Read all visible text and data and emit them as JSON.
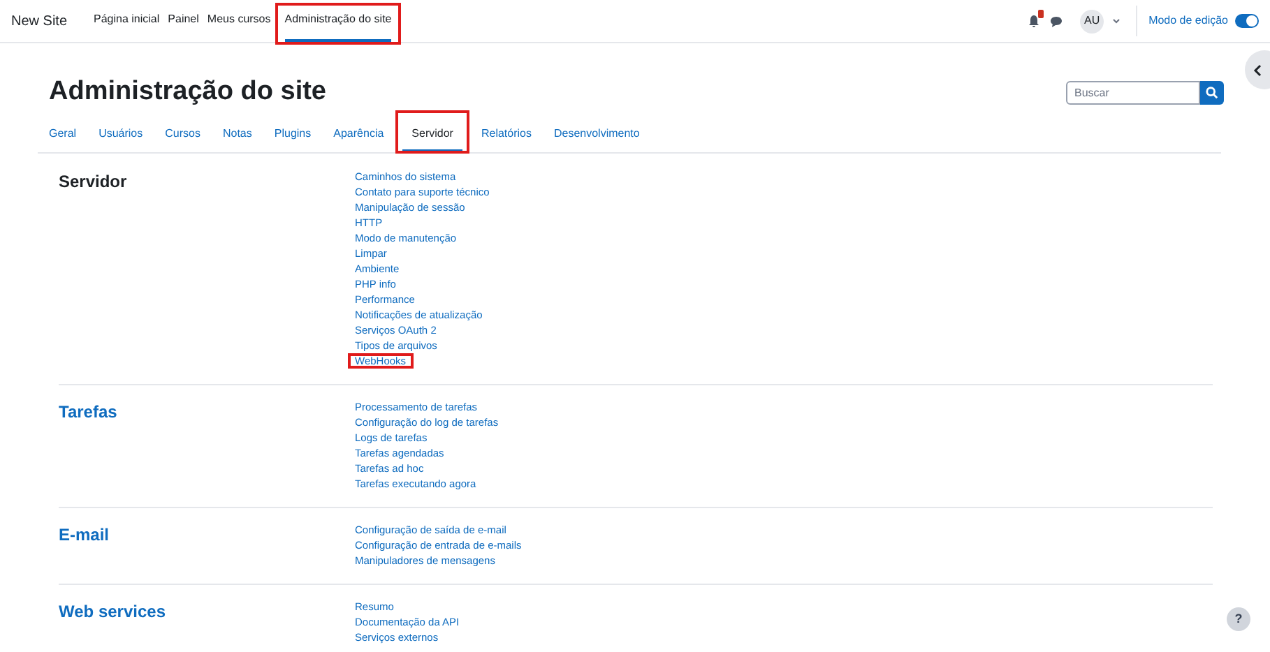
{
  "navbar": {
    "site_name": "New Site",
    "items": [
      {
        "label": "Página inicial",
        "selected": false,
        "highlighted": false
      },
      {
        "label": "Painel",
        "selected": false,
        "highlighted": false
      },
      {
        "label": "Meus cursos",
        "selected": false,
        "highlighted": false
      },
      {
        "label": "Administração do site",
        "selected": true,
        "highlighted": true
      }
    ],
    "user_initials": "AU",
    "edit_mode": {
      "label": "Modo de edição",
      "on": true
    }
  },
  "page": {
    "title": "Administração do site",
    "search": {
      "placeholder": "Buscar"
    },
    "tabs": [
      {
        "label": "Geral",
        "selected": false,
        "highlighted": false
      },
      {
        "label": "Usuários",
        "selected": false,
        "highlighted": false
      },
      {
        "label": "Cursos",
        "selected": false,
        "highlighted": false
      },
      {
        "label": "Notas",
        "selected": false,
        "highlighted": false
      },
      {
        "label": "Plugins",
        "selected": false,
        "highlighted": false
      },
      {
        "label": "Aparência",
        "selected": false,
        "highlighted": false
      },
      {
        "label": "Servidor",
        "selected": true,
        "highlighted": true
      },
      {
        "label": "Relatórios",
        "selected": false,
        "highlighted": false
      },
      {
        "label": "Desenvolvimento",
        "selected": false,
        "highlighted": false
      }
    ],
    "sections": [
      {
        "heading": "Servidor",
        "is_link": false,
        "links": [
          {
            "label": "Caminhos do sistema",
            "highlighted": false
          },
          {
            "label": "Contato para suporte técnico",
            "highlighted": false
          },
          {
            "label": "Manipulação de sessão",
            "highlighted": false
          },
          {
            "label": "HTTP",
            "highlighted": false
          },
          {
            "label": "Modo de manutenção",
            "highlighted": false
          },
          {
            "label": "Limpar",
            "highlighted": false
          },
          {
            "label": "Ambiente",
            "highlighted": false
          },
          {
            "label": "PHP info",
            "highlighted": false
          },
          {
            "label": "Performance",
            "highlighted": false
          },
          {
            "label": "Notificações de atualização",
            "highlighted": false
          },
          {
            "label": "Serviços OAuth 2",
            "highlighted": false
          },
          {
            "label": "Tipos de arquivos",
            "highlighted": false
          },
          {
            "label": "WebHooks",
            "highlighted": true
          }
        ]
      },
      {
        "heading": "Tarefas",
        "is_link": true,
        "links": [
          {
            "label": "Processamento de tarefas",
            "highlighted": false
          },
          {
            "label": "Configuração do log de tarefas",
            "highlighted": false
          },
          {
            "label": "Logs de tarefas",
            "highlighted": false
          },
          {
            "label": "Tarefas agendadas",
            "highlighted": false
          },
          {
            "label": "Tarefas ad hoc",
            "highlighted": false
          },
          {
            "label": "Tarefas executando agora",
            "highlighted": false
          }
        ]
      },
      {
        "heading": "E-mail",
        "is_link": true,
        "links": [
          {
            "label": "Configuração de saída de e-mail",
            "highlighted": false
          },
          {
            "label": "Configuração de entrada de e-mails",
            "highlighted": false
          },
          {
            "label": "Manipuladores de mensagens",
            "highlighted": false
          }
        ]
      },
      {
        "heading": "Web services",
        "is_link": true,
        "links": [
          {
            "label": "Resumo",
            "highlighted": false
          },
          {
            "label": "Documentação da API",
            "highlighted": false
          },
          {
            "label": "Serviços externos",
            "highlighted": false
          }
        ]
      }
    ]
  },
  "help_button": {
    "label": "?"
  }
}
